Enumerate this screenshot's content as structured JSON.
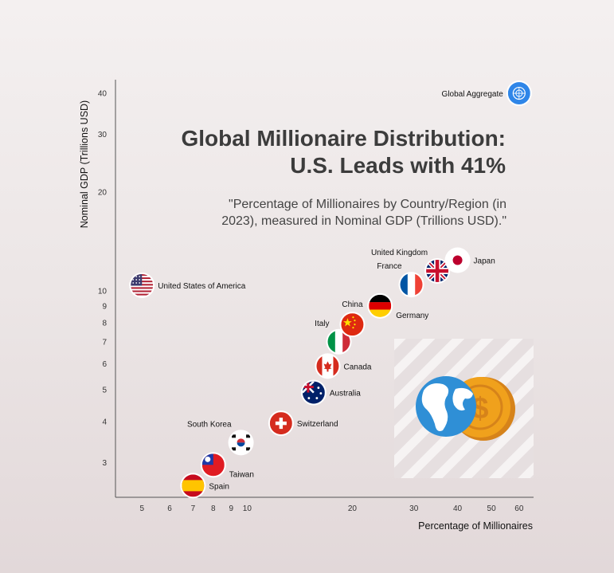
{
  "chart_data": {
    "type": "scatter",
    "title_line1": "Global Millionaire Distribution:",
    "title_line2": "U.S. Leads with 41%",
    "subtitle_line1": "\"Percentage of Millionaires by Country/Region (in",
    "subtitle_line2": "2023), measured in Nominal GDP (Trillions USD).\"",
    "xlabel": "Percentage of Millionaires",
    "ylabel": "Nominal GDP (Trillions USD)",
    "x_scale": "log",
    "y_scale": "log",
    "xlim": [
      4.2,
      66
    ],
    "ylim": [
      2.35,
      44
    ],
    "x_ticks": [
      5,
      6,
      7,
      8,
      9,
      10,
      20,
      30,
      40,
      50,
      60
    ],
    "y_ticks": [
      3,
      4,
      5,
      6,
      7,
      8,
      9,
      10,
      20,
      30,
      40
    ],
    "grid": false,
    "points": [
      {
        "label": "United States of America",
        "x": 5.0,
        "y": 10.4,
        "flag": "usa",
        "label_side": "right"
      },
      {
        "label": "Spain",
        "x": 7.0,
        "y": 2.55,
        "flag": "spain",
        "label_side": "right"
      },
      {
        "label": "Taiwan",
        "x": 8.0,
        "y": 2.95,
        "flag": "taiwan",
        "label_side": "right-below"
      },
      {
        "label": "South Korea",
        "x": 9.6,
        "y": 3.45,
        "flag": "south-korea",
        "label_side": "left-above"
      },
      {
        "label": "Switzerland",
        "x": 12.5,
        "y": 3.95,
        "flag": "switzerland",
        "label_side": "right"
      },
      {
        "label": "Australia",
        "x": 15.5,
        "y": 4.9,
        "flag": "australia",
        "label_side": "right"
      },
      {
        "label": "Canada",
        "x": 17.0,
        "y": 5.9,
        "flag": "canada",
        "label_side": "right"
      },
      {
        "label": "Italy",
        "x": 18.3,
        "y": 7.0,
        "flag": "italy",
        "label_side": "left-above"
      },
      {
        "label": "China",
        "x": 20.0,
        "y": 7.9,
        "flag": "china",
        "label_side": "above"
      },
      {
        "label": "Germany",
        "x": 24.0,
        "y": 9.0,
        "flag": "germany",
        "label_side": "right-below"
      },
      {
        "label": "France",
        "x": 29.5,
        "y": 10.45,
        "flag": "france",
        "label_side": "left-above"
      },
      {
        "label": "United Kingdom",
        "x": 35.0,
        "y": 11.5,
        "flag": "uk",
        "label_side": "left-above"
      },
      {
        "label": "Japan",
        "x": 40.0,
        "y": 12.4,
        "flag": "japan",
        "label_side": "right"
      },
      {
        "label": "Global Aggregate",
        "x": 60.0,
        "y": 40.0,
        "flag": "un",
        "label_side": "left"
      }
    ],
    "colors": {
      "axis": "#555555",
      "globe": "#2f8fd6",
      "coin": "#f0a11c",
      "coin_dark": "#d6831a",
      "un_blue": "#2f86e8"
    }
  },
  "decoration": {
    "icon": "globe-and-dollar-coin-icon"
  }
}
